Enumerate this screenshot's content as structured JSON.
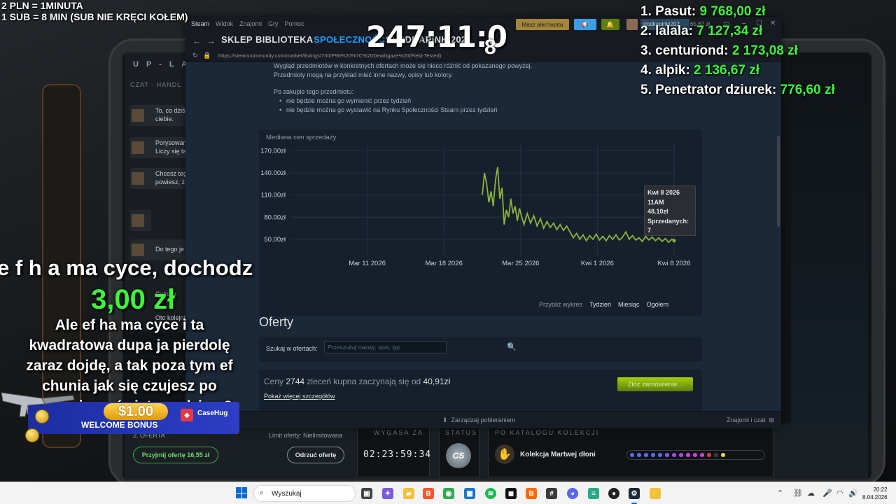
{
  "stream_overlay": {
    "rate_line1": "2 PLN =  1MINUTA",
    "rate_line2": "1 SUB = 8 MIN (SUB NIE KRĘCI KOŁEM)",
    "timer": "247:11:0",
    "timer_sub": "8",
    "leaderboard": [
      {
        "rank": "1.",
        "name": "Pasut:",
        "amount": "9 768,00 zł"
      },
      {
        "rank": "2.",
        "name": "lalala:",
        "amount": "7 127,34 zł"
      },
      {
        "rank": "3.",
        "name": "centuriond:",
        "amount": "2 173,08 zł"
      },
      {
        "rank": "4.",
        "name": "alpik:",
        "amount": "2 136,67 zł"
      },
      {
        "rank": "5.",
        "name": "Penetrator dziurek:",
        "amount": "776,60 zł"
      }
    ],
    "donation_title": "e f h a ma cyce, dochodz",
    "donation_amount": "3,00 zł",
    "donation_message": "Ale ef ha ma cyce i ta kwadratowa dupa ja pierdolę zaraz dojdę, a tak poza tym ef chunia jak się czujesz po powrocie ze świąt z rodziną ?",
    "bonus_amount": "$1.00",
    "bonus_label": "WELCOME BONUS",
    "bonus_brand": "CaseHug"
  },
  "background_app": {
    "logo": "U P - L A",
    "chat_header": "CZAT - HANDL",
    "messages": [
      {
        "text": "To, co dziś\nciebie."
      },
      {
        "text": "Porysowan\nLiczy się ta"
      },
      {
        "text": "Chcesz teg\npowiesz, ż"
      },
      {
        "text": ""
      },
      {
        "text": "Do tego je"
      },
      {
        "text": "Cokolw"
      },
      {
        "text": "Oto kolejni"
      }
    ],
    "offer_label": "2. OFERTA",
    "offer_limit": "Limit oferty: Nielimitowana",
    "accept_btn": "Przyjmij ofertę 16,55 zł",
    "reject_btn": "Odrzuć ofertę",
    "expires_label": "WYGASA ZA",
    "expires_value": "02:23:59:34",
    "status_label": "STATUS",
    "status_icon_text": "CS",
    "collection_label": "PO KATALOGU KOLEKCJI",
    "collection_name": "Kolekcja Martwej dłoni",
    "dot_colors": [
      "#5b6cff",
      "#5b6cff",
      "#5b6cff",
      "#5b6cff",
      "#5b6cff",
      "#a24cff",
      "#a24cff",
      "#a24cff",
      "#e23cd9",
      "#e23cd9",
      "#e23cd9",
      "#e23b3b",
      "#3a3a3a",
      "#f2d33b"
    ]
  },
  "steam": {
    "menu": [
      "Steam",
      "Widok",
      "Znajomi",
      "Gry",
      "Pomoc"
    ],
    "alert_button": "Masz alert konta",
    "username": "slodkapinki202",
    "balance": "65,62 zł",
    "tabs": [
      "SKLEP",
      "BIBLIOTEKA",
      "SPOŁECZNOŚĆ",
      "SLODKAPINKI202"
    ],
    "url": "https://steamcommunity.com/market/listings/730/P90%20%7C%20Deathgaze%20(Field-Tested)",
    "desc_text": "Wygląd przedmiotów w konkretnych ofertach może się nieco różnić od pokazanego powyżej. Przedmioty mogą na przykład mieć inne nazwy, opisy lub kolory.",
    "purchase_note": "Po zakupie tego przedmiotu:",
    "purchase_bullets": [
      "nie będzie można go wymienić przez tydzień",
      "nie będzie można go wystawić na Rynku Społeczności Steam przez tydzień"
    ],
    "chart_title": "Mediana cen sprzedaży",
    "zoom_label": "Przybliż wykres",
    "zoom_options": [
      "Tydzień",
      "Miesiąc",
      "Ogółem"
    ],
    "tooltip": {
      "date": "Kwi 8 2026",
      "hour": "11AM",
      "price": "48.10zł",
      "sold_label": "Sprzedanych:",
      "sold": "7"
    },
    "offers_title": "Oferty",
    "search_label": "Szukaj w ofertach:",
    "search_placeholder": "Przeszukuj nazwy, opis, typ",
    "bids_prefix": "Ceny",
    "bids_count": "2744",
    "bids_middle": "zleceń kupna zaczynają się od",
    "bids_price": "40,91zł",
    "more_details": "Pokaż więcej szczegółów",
    "order_button": "Złóż zamówienie...",
    "footer_downloads": "Zarządzaj pobieraniem",
    "footer_friends": "Znajomi i czat"
  },
  "chart_data": {
    "type": "line",
    "title": "Mediana cen sprzedaży",
    "xlabel": "",
    "ylabel": "",
    "x_ticks": [
      "Mar 11 2026",
      "Mar 18 2026",
      "Mar 25 2026",
      "Kwi 1 2026",
      "Kwi 8 2026"
    ],
    "y_ticks": [
      "170.00zł",
      "140.00zł",
      "110.00zł",
      "80.00zł",
      "50.00zł"
    ],
    "ylim": [
      28,
      180
    ],
    "xlim": [
      0,
      35
    ],
    "line_color": "#8bb33d",
    "series": [
      {
        "values": [
          [
            17.5,
            110
          ],
          [
            17.7,
            140
          ],
          [
            17.9,
            125
          ],
          [
            18.1,
            100
          ],
          [
            18.3,
            115
          ],
          [
            18.5,
            95
          ],
          [
            18.7,
            130
          ],
          [
            18.9,
            148
          ],
          [
            19.1,
            105
          ],
          [
            19.3,
            120
          ],
          [
            19.5,
            70
          ],
          [
            19.7,
            90
          ],
          [
            19.9,
            80
          ],
          [
            20.1,
            105
          ],
          [
            20.3,
            85
          ],
          [
            20.5,
            95
          ],
          [
            20.7,
            75
          ],
          [
            20.9,
            92
          ],
          [
            21.1,
            80
          ],
          [
            21.3,
            70
          ],
          [
            21.6,
            85
          ],
          [
            21.9,
            72
          ],
          [
            22.2,
            82
          ],
          [
            22.5,
            68
          ],
          [
            22.8,
            78
          ],
          [
            23.1,
            65
          ],
          [
            23.4,
            74
          ],
          [
            23.7,
            66
          ],
          [
            24.0,
            72
          ],
          [
            24.3,
            63
          ],
          [
            24.6,
            70
          ],
          [
            24.9,
            62
          ],
          [
            25.2,
            68
          ],
          [
            25.5,
            60
          ],
          [
            25.8,
            52
          ],
          [
            26.1,
            58
          ],
          [
            26.4,
            50
          ],
          [
            26.7,
            56
          ],
          [
            27.0,
            48
          ],
          [
            27.3,
            55
          ],
          [
            27.6,
            50
          ],
          [
            27.9,
            57
          ],
          [
            28.2,
            49
          ],
          [
            28.5,
            54
          ],
          [
            28.8,
            48
          ],
          [
            29.1,
            55
          ],
          [
            29.4,
            50
          ],
          [
            29.7,
            56
          ],
          [
            30.0,
            49
          ],
          [
            30.3,
            53
          ],
          [
            30.6,
            60
          ],
          [
            30.9,
            50
          ],
          [
            31.2,
            55
          ],
          [
            31.5,
            49
          ],
          [
            31.8,
            52
          ],
          [
            32.1,
            47
          ],
          [
            32.4,
            54
          ],
          [
            32.7,
            49
          ],
          [
            33.0,
            53
          ],
          [
            33.3,
            48
          ],
          [
            33.6,
            52
          ],
          [
            33.9,
            47
          ],
          [
            34.2,
            51
          ],
          [
            34.5,
            46
          ],
          [
            34.8,
            50
          ],
          [
            35.0,
            48
          ]
        ]
      }
    ],
    "tooltip_value": 48.1
  },
  "taskbar": {
    "search_label": "Wyszukaj",
    "time": "20:22",
    "date": "8.04.2026"
  }
}
